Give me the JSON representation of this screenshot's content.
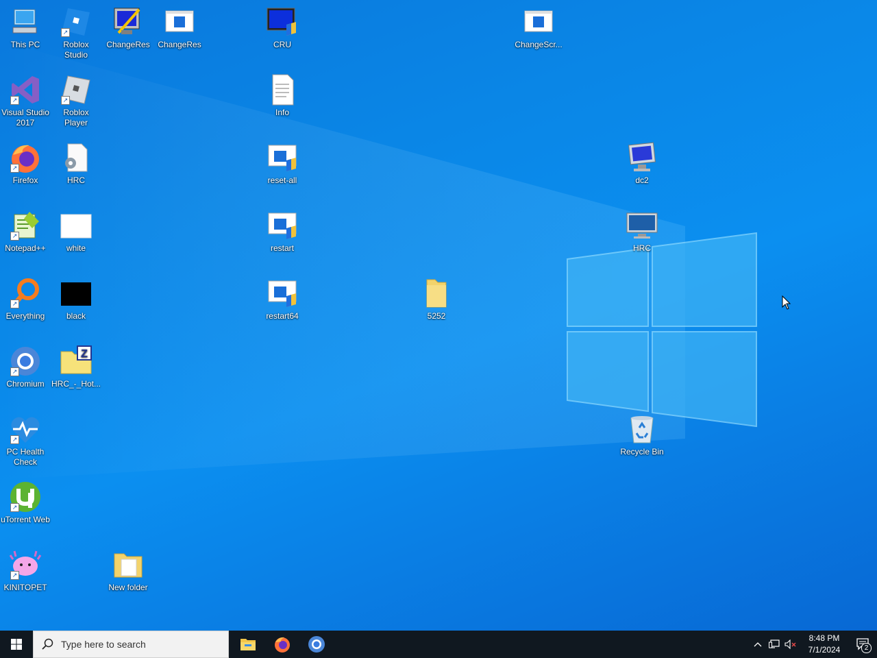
{
  "desktop": {
    "icons": [
      {
        "name": "this-pc-icon",
        "label": "This PC"
      },
      {
        "name": "roblox-studio-icon",
        "label": "Roblox Studio"
      },
      {
        "name": "changeres-exe-icon",
        "label": "ChangeRes"
      },
      {
        "name": "changeres-window-icon",
        "label": "ChangeRes"
      },
      {
        "name": "cru-icon",
        "label": "CRU"
      },
      {
        "name": "changescr-icon",
        "label": "ChangeScr..."
      },
      {
        "name": "visual-studio-icon",
        "label": "Visual Studio 2017"
      },
      {
        "name": "roblox-player-icon",
        "label": "Roblox Player"
      },
      {
        "name": "info-text-icon",
        "label": "Info"
      },
      {
        "name": "firefox-icon",
        "label": "Firefox"
      },
      {
        "name": "hrc-settings-icon",
        "label": "HRC"
      },
      {
        "name": "reset-all-icon",
        "label": "reset-all"
      },
      {
        "name": "dc2-icon",
        "label": "dc2"
      },
      {
        "name": "notepadpp-icon",
        "label": "Notepad++"
      },
      {
        "name": "white-image-icon",
        "label": "white"
      },
      {
        "name": "restart-icon",
        "label": "restart"
      },
      {
        "name": "hrc-monitor-icon",
        "label": "HRC"
      },
      {
        "name": "everything-icon",
        "label": "Everything"
      },
      {
        "name": "black-image-icon",
        "label": "black"
      },
      {
        "name": "restart64-icon",
        "label": "restart64"
      },
      {
        "name": "folder-5252-icon",
        "label": "5252"
      },
      {
        "name": "chromium-icon",
        "label": "Chromium"
      },
      {
        "name": "hrc-hot-zip-icon",
        "label": "HRC_-_Hot..."
      },
      {
        "name": "pc-health-check-icon",
        "label": "PC Health Check"
      },
      {
        "name": "recycle-bin-icon",
        "label": "Recycle Bin"
      },
      {
        "name": "utorrent-web-icon",
        "label": "uTorrent Web"
      },
      {
        "name": "kinitopet-icon",
        "label": "KINITOPET"
      },
      {
        "name": "new-folder-icon",
        "label": "New folder"
      }
    ]
  },
  "taskbar": {
    "search_placeholder": "Type here to search",
    "pinned": [
      "file-explorer-icon",
      "firefox-icon",
      "chromium-icon"
    ],
    "clock_time": "8:48 PM",
    "clock_date": "7/1/2024",
    "notification_count": "2"
  },
  "colors": {
    "desktop_blue": "#0a86e6",
    "taskbar": "#101820"
  }
}
